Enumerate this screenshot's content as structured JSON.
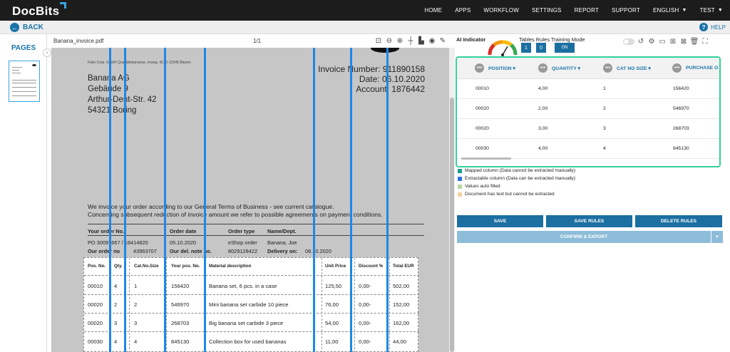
{
  "header": {
    "logo": "DocBits",
    "nav": [
      "HOME",
      "APPS",
      "WORKFLOW",
      "SETTINGS",
      "REPORT",
      "SUPPORT",
      "ENGLISH",
      "TEST"
    ]
  },
  "subbar": {
    "back_label": "BACK",
    "help_label": "HELP"
  },
  "pages_panel": {
    "title": "PAGES"
  },
  "viewer": {
    "filename": "Banana_invoice.pdf",
    "page_indicator": "1/1"
  },
  "document": {
    "sender_line": "Fake Corp. GmbH Qualitätsbananas, Irrweg, 42, D-12345 Blasen",
    "recipient": [
      "Banana AG",
      "Gebäude 9",
      "Arthur-Dent-Str. 42",
      "54321 Boring"
    ],
    "invoice_number": "Invoice Number: 911890158",
    "date": "Date: 06.10.2020",
    "account": "Account: 1876442",
    "terms_1": "We invoice your order according to our General Terms of Business - see current catalogue.",
    "terms_2": "Concerning subsequent reduction of invoice amount we refer to possible agreements on payment conditions.",
    "order": {
      "your_order_label": "Your order No.",
      "order_date_label": "Order date",
      "order_type_label": "Order type",
      "name_dept_label": "Name/Dept.",
      "your_order_value": "PO 30097667 / 18414820",
      "order_date_value": "05.10.2020",
      "order_type_value": "eShop order",
      "name_dept_value": "Banana, Joe",
      "our_order_label": "Our order no",
      "our_order_value": "43963707",
      "del_note_label": "Our del. note no.",
      "del_note_value": "8029128422",
      "delivery_label": "Delivery on:",
      "delivery_value": "08.10.2020"
    },
    "table": {
      "headers": [
        "Pos. No.",
        "Qty.",
        "Cat.No.Size",
        "Your pos. No.",
        "Material description",
        "Unit Price",
        "Discount %",
        "Total EUR"
      ],
      "rows": [
        [
          "00010",
          "4",
          "1",
          "156420",
          "Banana set, 6 pcs. in a case",
          "125,50",
          "0,00-",
          "502,00"
        ],
        [
          "00020",
          "2",
          "2",
          "546970",
          "Mini banana set carbide 10 piece",
          "76,00",
          "0,00-",
          "152,00"
        ],
        [
          "00020",
          "3",
          "3",
          "268703",
          "Big banana set carbide 3 piece",
          "54,00",
          "0,00-",
          "162,00"
        ],
        [
          "00030",
          "4",
          "4",
          "845130",
          "Collection box for used bananas",
          "11,00",
          "0,00-",
          "44,00"
        ]
      ]
    }
  },
  "right_panel": {
    "ai_indicator_label": "AI Indicator",
    "modes_label": "Tables Rules Training Mode",
    "tables_count": "1",
    "rules_count": "0",
    "training_mode": "ON",
    "grid": {
      "columns": [
        "POSITION",
        "QUANTITY",
        "CAT NO SIZE",
        "PURCHASE O"
      ],
      "rows": [
        [
          "00010",
          "4,00",
          "1",
          "156420"
        ],
        [
          "00020",
          "2,00",
          "2",
          "546970"
        ],
        [
          "00020",
          "3,00",
          "3",
          "268703"
        ],
        [
          "00030",
          "4,00",
          "4",
          "845130"
        ]
      ]
    },
    "legend": [
      {
        "label": "Mapped column (Data cannot be extracted manually)",
        "color": "#1a9a8a"
      },
      {
        "label": "Extractable column (Data can be extracted manually)",
        "color": "#2f6fe0"
      },
      {
        "label": "Values auto filled",
        "color": "#b6d7a0"
      },
      {
        "label": "Document has text but cannot be extracted",
        "color": "#f3d3a3"
      }
    ],
    "buttons": {
      "save": "SAVE",
      "save_rules": "SAVE RULES",
      "delete_rules": "DELETE RULES",
      "confirm_export": "CONFIRM & EXPORT"
    }
  }
}
